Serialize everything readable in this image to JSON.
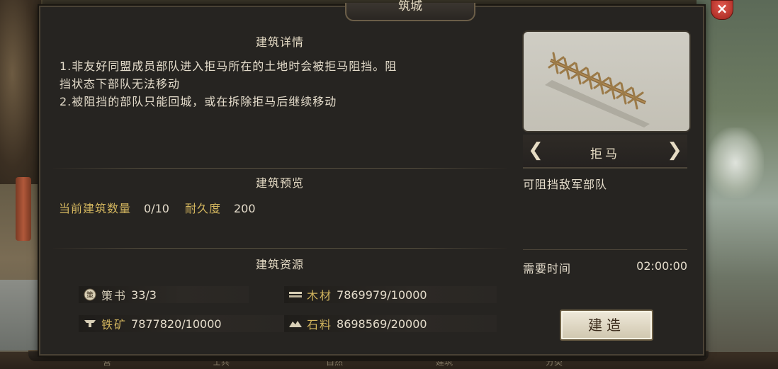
{
  "window": {
    "title": "筑城",
    "close_icon": "close-icon"
  },
  "details": {
    "heading": "建筑详情",
    "line1": "1.非友好同盟成员部队进入拒马所在的土地时会被拒马阻挡。阻",
    "line2": "挡状态下部队无法移动",
    "line3": "2.被阻挡的部队只能回城，或在拆除拒马后继续移动"
  },
  "preview_section": {
    "heading": "建筑预览",
    "count_label": "当前建筑数量",
    "count_value": "0/10",
    "durability_label": "耐久度",
    "durability_value": "200"
  },
  "resources": {
    "heading": "建筑资源",
    "items": [
      {
        "icon": "strategy-book-icon",
        "name": "策书",
        "value": "33/3"
      },
      {
        "icon": "wood-icon",
        "name": "木材",
        "value": "7869979/10000"
      },
      {
        "icon": "iron-icon",
        "name": "铁矿",
        "value": "7877820/10000"
      },
      {
        "icon": "stone-icon",
        "name": "石料",
        "value": "8698569/20000"
      }
    ]
  },
  "building": {
    "name": "拒马",
    "description": "可阻挡敌军部队",
    "time_label": "需要时间",
    "time_value": "02:00:00",
    "build_button": "建造"
  },
  "bottom_bar": [
    "营",
    "士兵",
    "自然",
    "建筑",
    "分类"
  ]
}
